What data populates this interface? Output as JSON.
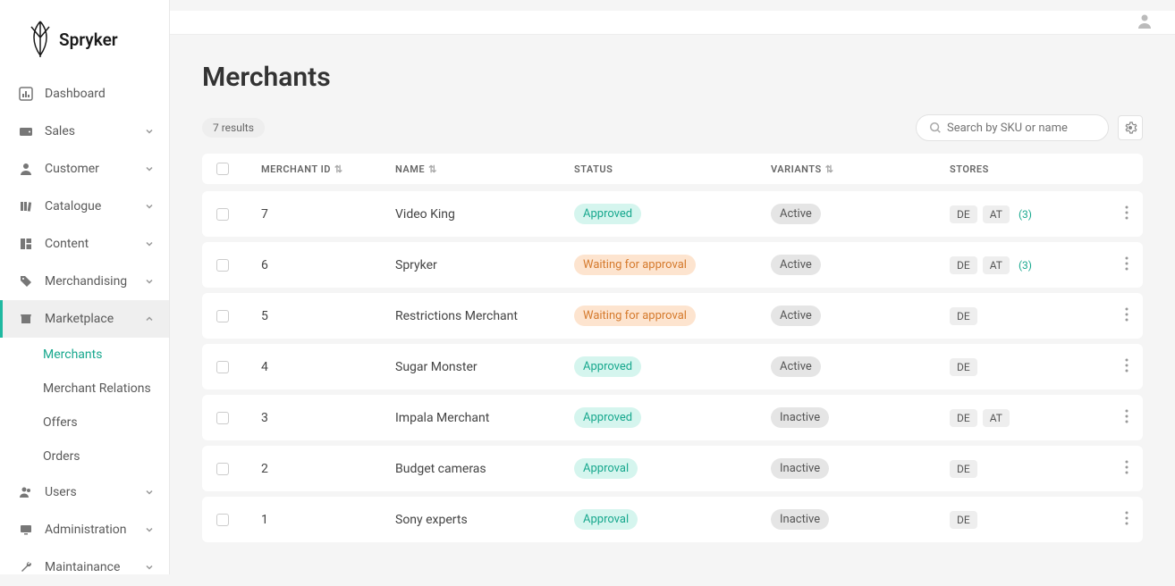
{
  "brand": "Spryker",
  "sidebar": {
    "items": [
      {
        "label": "Dashboard",
        "expandable": false
      },
      {
        "label": "Sales",
        "expandable": true
      },
      {
        "label": "Customer",
        "expandable": true
      },
      {
        "label": "Catalogue",
        "expandable": true
      },
      {
        "label": "Content",
        "expandable": true
      },
      {
        "label": "Merchandising",
        "expandable": true
      },
      {
        "label": "Marketplace",
        "expandable": true,
        "active": true
      },
      {
        "label": "Users",
        "expandable": true
      },
      {
        "label": "Administration",
        "expandable": true
      },
      {
        "label": "Maintainance",
        "expandable": true
      }
    ],
    "marketplace_sub": [
      {
        "label": "Merchants",
        "selected": true
      },
      {
        "label": "Merchant Relations"
      },
      {
        "label": "Offers"
      },
      {
        "label": "Orders"
      }
    ]
  },
  "page": {
    "title": "Merchants",
    "results_text": "7 results",
    "search_placeholder": "Search by SKU or name"
  },
  "columns": {
    "merchant_id": "MERCHANT ID",
    "name": "NAME",
    "status": "STATUS",
    "variants": "VARIANTS",
    "stores": "STORES"
  },
  "rows": [
    {
      "id": "7",
      "name": "Video King",
      "status": "Approved",
      "status_class": "approved",
      "variant": "Active",
      "variant_class": "active",
      "stores": [
        "DE",
        "AT"
      ],
      "more": "(3)"
    },
    {
      "id": "6",
      "name": "Spryker",
      "status": "Waiting for approval",
      "status_class": "waiting",
      "variant": "Active",
      "variant_class": "active",
      "stores": [
        "DE",
        "AT"
      ],
      "more": "(3)"
    },
    {
      "id": "5",
      "name": "Restrictions Merchant",
      "status": "Waiting for approval",
      "status_class": "waiting",
      "variant": "Active",
      "variant_class": "active",
      "stores": [
        "DE"
      ],
      "more": ""
    },
    {
      "id": "4",
      "name": "Sugar Monster",
      "status": "Approved",
      "status_class": "approved",
      "variant": "Active",
      "variant_class": "active",
      "stores": [
        "DE"
      ],
      "more": ""
    },
    {
      "id": "3",
      "name": "Impala Merchant",
      "status": "Approved",
      "status_class": "approved",
      "variant": "Inactive",
      "variant_class": "inactive",
      "stores": [
        "DE",
        "AT"
      ],
      "more": ""
    },
    {
      "id": "2",
      "name": "Budget cameras",
      "status": "Approval",
      "status_class": "approval",
      "variant": "Inactive",
      "variant_class": "inactive",
      "stores": [
        "DE"
      ],
      "more": ""
    },
    {
      "id": "1",
      "name": "Sony experts",
      "status": "Approval",
      "status_class": "approval",
      "variant": "Inactive",
      "variant_class": "inactive",
      "stores": [
        "DE"
      ],
      "more": ""
    }
  ]
}
